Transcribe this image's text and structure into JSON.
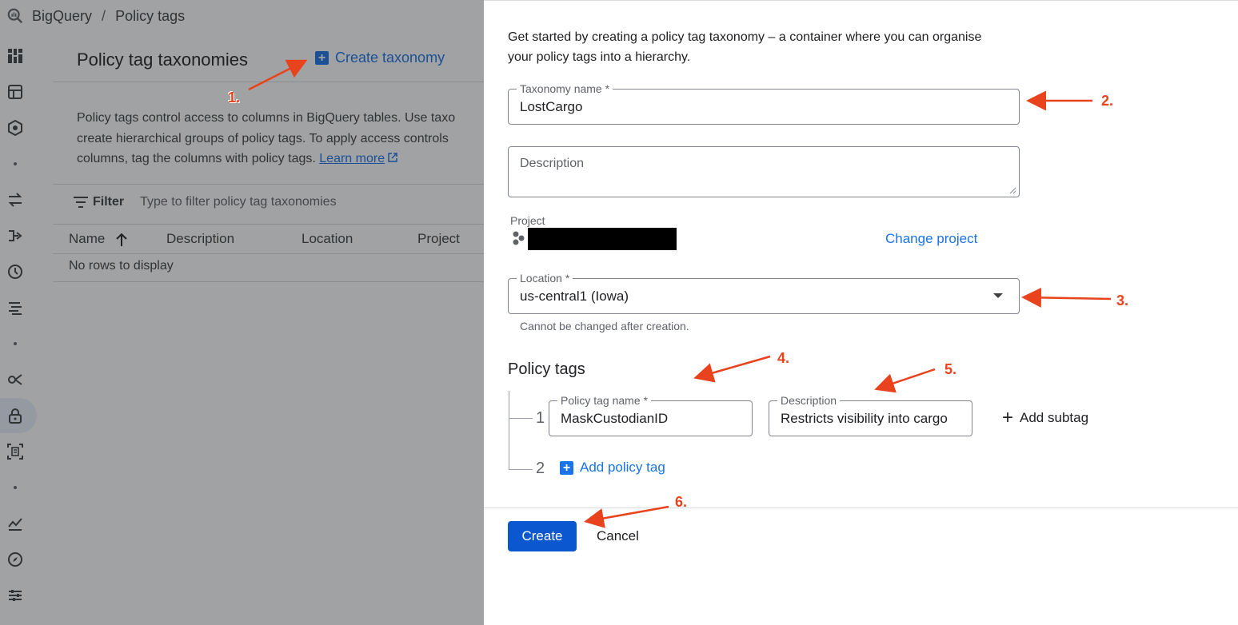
{
  "topbar": {
    "app": "BigQuery",
    "separator": "/",
    "page": "Policy tags"
  },
  "background": {
    "header_title": "Policy tag taxonomies",
    "create_taxonomy": "Create taxonomy",
    "description_lines": [
      "Policy tags control access to columns in BigQuery tables. Use taxo",
      "create hierarchical groups of policy tags. To apply access controls",
      "columns, tag the columns with policy tags."
    ],
    "learn_more": "Learn more",
    "filter_label": "Filter",
    "filter_placeholder": "Type to filter policy tag taxonomies",
    "columns": [
      "Name",
      "Description",
      "Location",
      "Project"
    ],
    "empty_message": "No rows to display"
  },
  "panel": {
    "intro": "Get started by creating a policy tag taxonomy – a container where you can organise your policy tags into a hierarchy.",
    "taxonomy_name_label": "Taxonomy name *",
    "taxonomy_name_value": "LostCargo",
    "description_placeholder": "Description",
    "project_label": "Project",
    "change_project": "Change project",
    "location_label": "Location *",
    "location_value": "us-central1 (Iowa)",
    "location_hint": "Cannot be changed after creation.",
    "policy_tags_title": "Policy tags",
    "tags": [
      {
        "number": "1",
        "name_label": "Policy tag name *",
        "name_value": "MaskCustodianID",
        "desc_label": "Description",
        "desc_value": "Restricts visibility into cargo"
      }
    ],
    "next_number": "2",
    "add_subtag": "Add subtag",
    "add_policy_tag": "Add policy tag",
    "create_button": "Create",
    "cancel_button": "Cancel"
  },
  "annotations": [
    "1.",
    "2.",
    "3.",
    "4.",
    "5.",
    "6."
  ],
  "colors": {
    "accent": "#1a73e8",
    "primary_button": "#0b57d0",
    "annotation": "#e8431c"
  }
}
